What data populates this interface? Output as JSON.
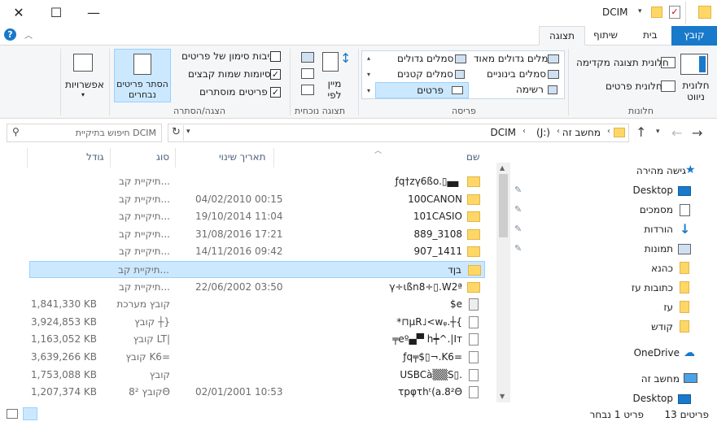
{
  "window": {
    "title": "DCIM",
    "minimize": "—",
    "maximize": "☐",
    "close": "✕"
  },
  "tabs": {
    "file": "קובץ",
    "home": "בית",
    "share": "שיתוף",
    "view": "תצוגה"
  },
  "ribbon": {
    "panes_group": "חלונות",
    "navigation_pane": "חלונית ניווט",
    "preview_pane": "חלונית תצוגה מקדימה",
    "details_pane": "חלונית פרטים",
    "layout_group": "פריסה",
    "layouts": {
      "extra_large": "סמלים גדולים מאוד",
      "large": "סמלים גדולים",
      "medium": "סמלים בינוניים",
      "small": "סמלים קטנים",
      "list": "רשימה",
      "details": "פרטים"
    },
    "current_view_group": "תצוגה נוכחית",
    "sort_by": "מיין לפי",
    "show_hide_group": "הצגה/הסתרה",
    "item_checkboxes": "תיבות סימון של פריטים",
    "file_extensions": "סיומות שמות קבצים",
    "hidden_items": "פריטים מוסתרים",
    "hide_selected": "הסתר פריטים נבחרים",
    "options": "אפשרויות",
    "checkbox_states": {
      "item_checkboxes": false,
      "file_extensions": true,
      "hidden_items": true
    }
  },
  "address": {
    "path": [
      "מחשב זה",
      "(J:)",
      "DCIM"
    ],
    "search_placeholder": "חיפוש בתיקיית DCIM"
  },
  "columns": {
    "name": "שם",
    "date": "תאריך שינוי",
    "type": "סוג",
    "size": "גודל"
  },
  "files": [
    {
      "name": "ƒq†zγ6ßo.▯▄▖",
      "date": "",
      "type": "תיקיית קב...",
      "size": "",
      "kind": "folder"
    },
    {
      "name": "100CANON",
      "date": "04/02/2010 00:15",
      "type": "תיקיית קב...",
      "size": "",
      "kind": "folder"
    },
    {
      "name": "101CASIO",
      "date": "19/10/2014 11:04",
      "type": "תיקיית קב...",
      "size": "",
      "kind": "folder"
    },
    {
      "name": "889_3108",
      "date": "31/08/2016 17:21",
      "type": "תיקיית קב...",
      "size": "",
      "kind": "folder"
    },
    {
      "name": "907_1411",
      "date": "14/11/2016 09:42",
      "type": "תיקיית קב...",
      "size": "",
      "kind": "folder"
    },
    {
      "name": "בןד",
      "date": "",
      "type": "תיקיית קב...",
      "size": "",
      "kind": "folder",
      "selected": true
    },
    {
      "name": "γ÷ιßn8÷▯.W2ª",
      "date": "22/06/2002 03:50",
      "type": "תיקיית קב...",
      "size": "",
      "kind": "folder"
    },
    {
      "name": "$e",
      "date": "",
      "type": "קובץ מערכת",
      "size": "1,841,330 KB",
      "kind": "sysfile"
    },
    {
      "name": "*⊓μR˩<wᵩ.┼{",
      "date": "",
      "type": "קובץ ┼}",
      "size": "3,924,853 KB",
      "kind": "file"
    },
    {
      "name": "╤eº▄▀ h┿^.|Iт",
      "date": "",
      "type": "קובץ LT|",
      "size": "1,163,052 KB",
      "kind": "file"
    },
    {
      "name": "ƒq╤$▯¬.K6=",
      "date": "",
      "type": "קובץ K6=",
      "size": "3,639,266 KB",
      "kind": "file"
    },
    {
      "name": "USBCà▒▒S▯.",
      "date": "",
      "type": "קובץ",
      "size": "1,753,088 KB",
      "kind": "file"
    },
    {
      "name": "τрφτhᵗ(a.8²Θ",
      "date": "02/01/2001 10:53",
      "type": "קובץ 8²Θ",
      "size": "1,207,374 KB",
      "kind": "file"
    }
  ],
  "nav": {
    "quick_access": "גישה מהירה",
    "items": [
      "Desktop",
      "מסמכים",
      "הורדות",
      "תמונות",
      "כהנא",
      "כתובות עז",
      "עז",
      "קודש"
    ],
    "onedrive": "OneDrive",
    "this_pc": "מחשב זה",
    "pc_desktop": "Desktop"
  },
  "status": {
    "count": "13 פריטים",
    "selected": "פריט 1 נבחר"
  },
  "colors": {
    "accent": "#1979ca",
    "selection": "#cce8ff",
    "folder": "#ffd766"
  }
}
